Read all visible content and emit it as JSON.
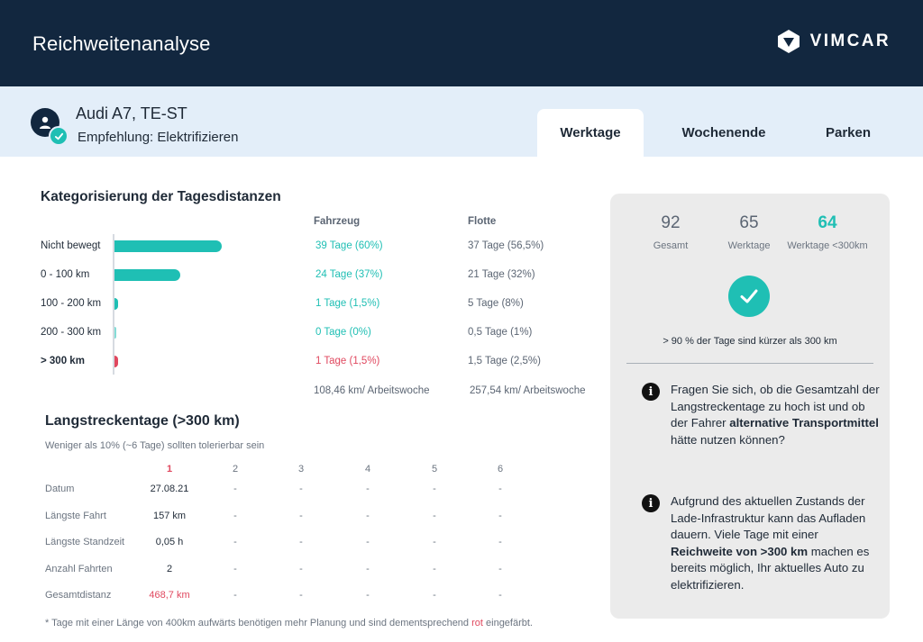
{
  "header": {
    "title": "Reichweitenanalyse",
    "brand": "VIMCAR"
  },
  "vehicle": {
    "name": "Audi A7, TE-ST",
    "recommendation": "Empfehlung: Elektrifizieren"
  },
  "tabs": [
    {
      "label": "Werktage",
      "active": true
    },
    {
      "label": "Wochenende",
      "active": false
    },
    {
      "label": "Parken",
      "active": false
    }
  ],
  "categorization": {
    "title": "Kategorisierung der Tagesdistanzen",
    "col_vehicle": "Fahrzeug",
    "col_fleet": "Flotte",
    "rows": [
      {
        "label": "Nicht bewegt",
        "vehicle": "39 Tage (60%)",
        "fleet": "37 Tage (56,5%)",
        "share": 0.6,
        "color": "#1fbfb4",
        "bold": false
      },
      {
        "label": "0 - 100 km",
        "vehicle": "24 Tage (37%)",
        "fleet": "21 Tage (32%)",
        "share": 0.37,
        "color": "#1fbfb4",
        "bold": false
      },
      {
        "label": "100 - 200 km",
        "vehicle": "1 Tage (1,5%)",
        "fleet": "5 Tage (8%)",
        "share": 0.015,
        "color": "#1fbfb4",
        "bold": false
      },
      {
        "label": "200 - 300 km",
        "vehicle": "0 Tage (0%)",
        "fleet": "0,5 Tage (1%)",
        "share": 0.0,
        "color": "#1fbfb4",
        "bold": false
      },
      {
        "label": "> 300 km",
        "vehicle": "1 Tage (1,5%)",
        "fleet": "1,5 Tage (2,5%)",
        "share": 0.015,
        "color": "#e0485f",
        "bold": true
      }
    ],
    "vehicle_summary": "108,46 km/ Arbeitswoche",
    "fleet_summary": "257,54 km/ Arbeitswoche"
  },
  "long_distance": {
    "title": "Langstreckentage (>300 km)",
    "note": "Weniger als 10% (~6 Tage) sollten tolerierbar sein",
    "columns": [
      "1",
      "2",
      "3",
      "4",
      "5",
      "6"
    ],
    "rows": [
      {
        "label": "Datum",
        "values": [
          "27.08.21",
          "-",
          "-",
          "-",
          "-",
          "-"
        ]
      },
      {
        "label": "Längste Fahrt",
        "values": [
          "157 km",
          "-",
          "-",
          "-",
          "-",
          "-"
        ]
      },
      {
        "label": "Längste Standzeit",
        "values": [
          "0,05 h",
          "-",
          "-",
          "-",
          "-",
          "-"
        ]
      },
      {
        "label": "Anzahl Fahrten",
        "values": [
          "2",
          "-",
          "-",
          "-",
          "-",
          "-"
        ]
      },
      {
        "label": "Gesamtdistanz",
        "values": [
          "468,7 km",
          "-",
          "-",
          "-",
          "-",
          "-"
        ]
      }
    ],
    "footnote_before": "* Tage mit einer Länge von 400km aufwärts benötigen mehr Planung und sind dementsprechend ",
    "footnote_red": "rot",
    "footnote_after": " eingefärbt."
  },
  "panel": {
    "stats": [
      {
        "value": "92",
        "label": "Gesamt"
      },
      {
        "value": "65",
        "label": "Werktage"
      },
      {
        "value": "64",
        "label": "Werktage <300km"
      }
    ],
    "check_caption": "> 90 % der Tage sind kürzer als 300 km",
    "info1": {
      "part1": "Fragen Sie sich, ob die Gesamtzahl der Langstreckentage zu hoch ist und ob der Fahrer ",
      "bold": "alternative Transportmittel",
      "part2": " hätte nutzen können?"
    },
    "info2": {
      "part1": "Aufgrund des aktuellen Zustands der Lade-Infrastruktur kann das Aufladen dauern. Viele Tage mit einer ",
      "bold": "Reichweite von >300 km",
      "part2": " machen es bereits möglich, Ihr aktuelles Auto zu elektrifizieren."
    }
  },
  "colors": {
    "navy": "#12273f",
    "accent": "#1fbfb4",
    "red": "#e0485f",
    "subheader_bg": "#e3eef9",
    "panel_bg": "#ebebeb"
  }
}
